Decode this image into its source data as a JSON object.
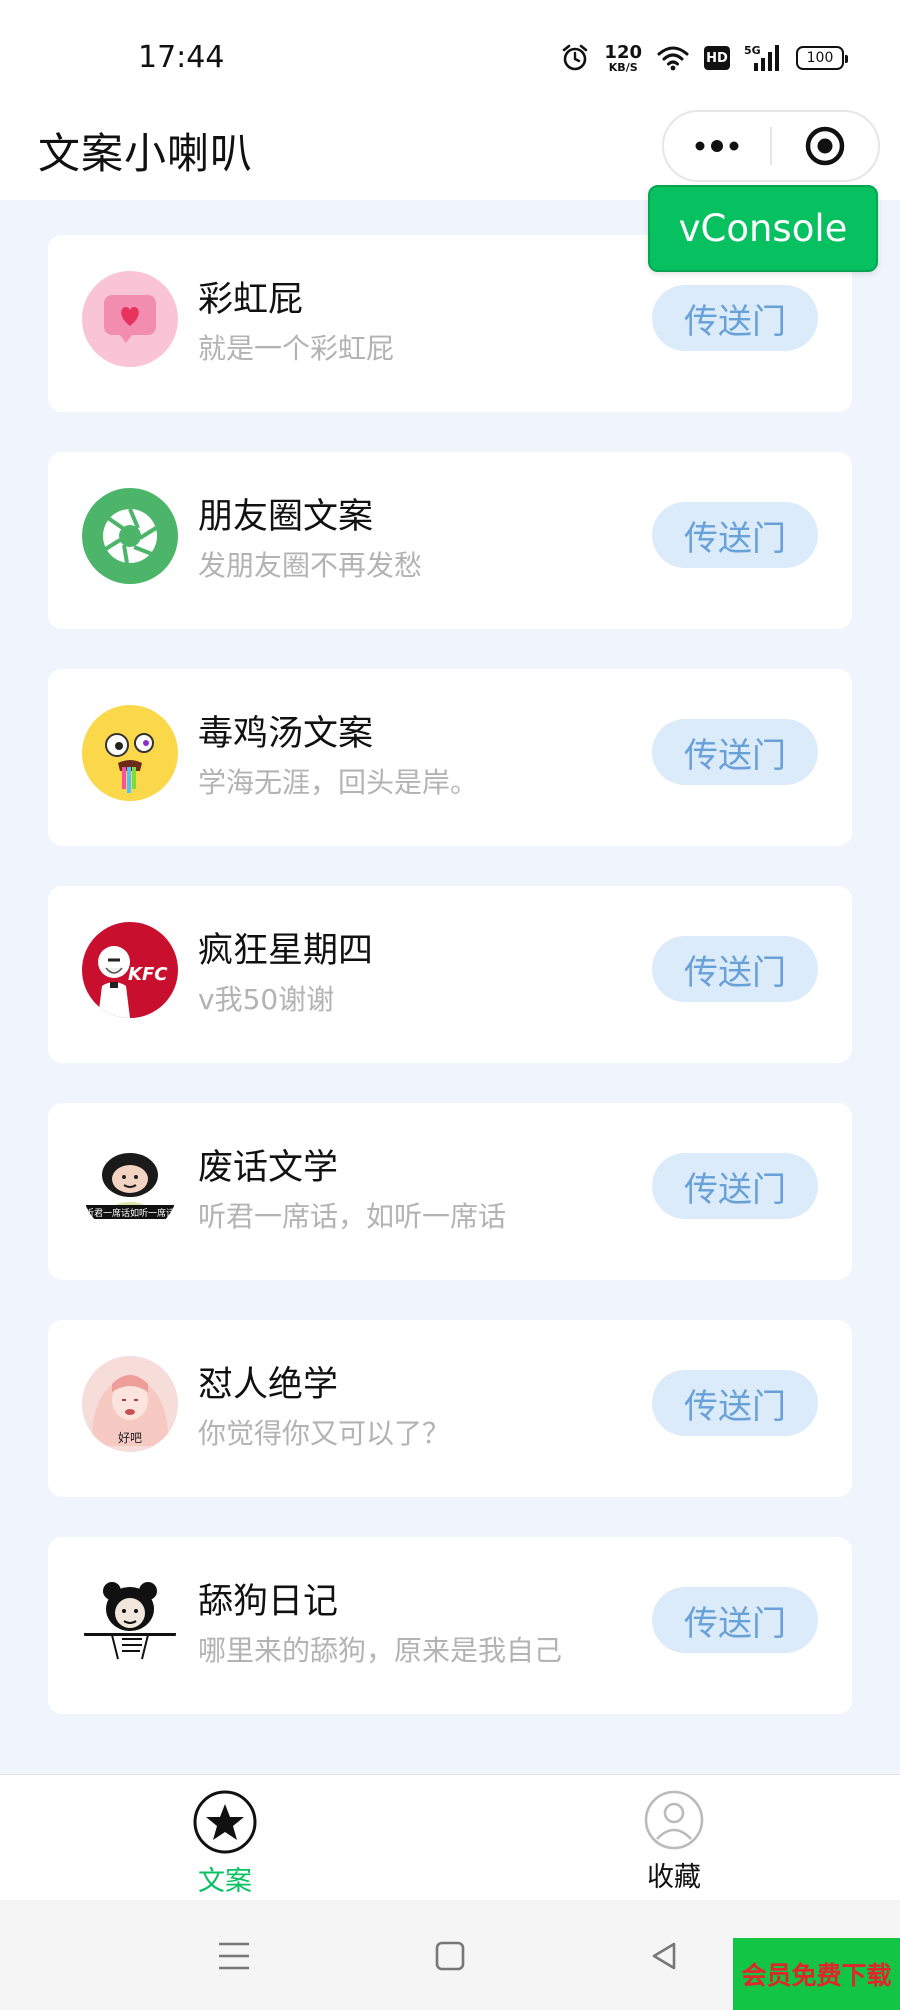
{
  "status_bar": {
    "time": "17:44",
    "net_speed_value": "120",
    "net_speed_unit": "KB/S",
    "hd": "HD",
    "signal_type": "5G",
    "battery": "100"
  },
  "header": {
    "title": "文案小喇叭",
    "more_icon": "more-dots-icon",
    "close_icon": "target-circle-icon"
  },
  "vconsole": {
    "label": "vConsole"
  },
  "cards": [
    {
      "title": "彩虹屁",
      "subtitle": "就是一个彩虹屁",
      "button": "传送门",
      "icon": "heart-message-icon"
    },
    {
      "title": "朋友圈文案",
      "subtitle": "发朋友圈不再发愁",
      "button": "传送门",
      "icon": "camera-shutter-icon"
    },
    {
      "title": "毒鸡汤文案",
      "subtitle": "学海无涯，回头是岸。",
      "button": "传送门",
      "icon": "crazy-face-icon"
    },
    {
      "title": "疯狂星期四",
      "subtitle": "v我50谢谢",
      "button": "传送门",
      "icon": "kfc-logo",
      "icon_text": "KFC"
    },
    {
      "title": "废话文学",
      "subtitle": "听君一席话，如听一席话",
      "button": "传送门",
      "icon": "meme-panda-icon",
      "icon_text": "听君一席话如听一席话"
    },
    {
      "title": "怼人绝学",
      "subtitle": "你觉得你又可以了？",
      "button": "传送门",
      "icon": "meme-girl-icon",
      "icon_text": "好吧"
    },
    {
      "title": "舔狗日记",
      "subtitle": "哪里来的舔狗，原来是我自己",
      "button": "传送门",
      "icon": "panda-meme-icon"
    }
  ],
  "tabbar": {
    "items": [
      {
        "label": "文案",
        "icon": "star-circle-icon",
        "active": true
      },
      {
        "label": "收藏",
        "icon": "user-circle-icon",
        "active": false
      }
    ]
  },
  "colors": {
    "accent": "#07c160",
    "button_bg": "#dcebfa",
    "button_text": "#68a0d8",
    "page_bg": "#eff4fd"
  },
  "watermark": {
    "text": "会员免费下载"
  }
}
